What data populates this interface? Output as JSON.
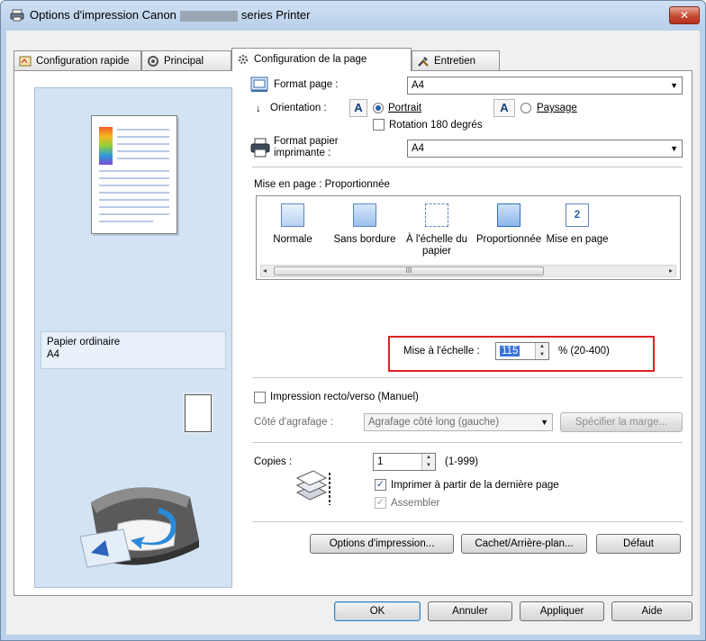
{
  "window": {
    "title_prefix": "Options d'impression Canon",
    "title_suffix": "series Printer",
    "close_label": "✕"
  },
  "tabs": [
    {
      "label": "Configuration rapide"
    },
    {
      "label": "Principal"
    },
    {
      "label": "Configuration de la page"
    },
    {
      "label": "Entretien"
    }
  ],
  "preview": {
    "media_type": "Papier ordinaire",
    "paper_size": "A4"
  },
  "page_setup": {
    "page_size_label": "Format page :",
    "page_size_value": "A4",
    "orientation_label": "Orientation :",
    "portrait_label": "Portrait",
    "landscape_label": "Paysage",
    "orientation_selected": "Portrait",
    "rotate_label": "Rotation 180 degrés",
    "rotate_checked": false,
    "printer_paper_label_1": "Format papier",
    "printer_paper_label_2": "imprimante :",
    "printer_paper_value": "A4",
    "icon_letter": "A"
  },
  "layout": {
    "label": "Mise en page : Proportionnée",
    "items": [
      {
        "label": "Normale"
      },
      {
        "label": "Sans bordure"
      },
      {
        "label": "À l'échelle du papier"
      },
      {
        "label": "Proportionnée"
      },
      {
        "label": "Mise en page"
      }
    ],
    "selected": "Proportionnée",
    "item5_badge": "2",
    "scroll_mark": "III"
  },
  "scaling": {
    "label": "Mise à l'échelle :",
    "value": "115",
    "range": "% (20-400)"
  },
  "duplex": {
    "label": "Impression recto/verso (Manuel)",
    "checked": false,
    "stapling_label": "Côté d'agrafage :",
    "stapling_value": "Agrafage côté long (gauche)",
    "margin_button": "Spécifier la marge..."
  },
  "copies": {
    "label": "Copies :",
    "value": "1",
    "range": "(1-999)",
    "reverse_label": "Imprimer à partir de la dernière page",
    "reverse_checked": true,
    "collate_label": "Assembler",
    "collate_checked": true
  },
  "bottom_buttons": {
    "print_options": "Options d'impression...",
    "stamp_background": "Cachet/Arrière-plan...",
    "defaults": "Défaut"
  },
  "dialog_buttons": {
    "ok": "OK",
    "cancel": "Annuler",
    "apply": "Appliquer",
    "help": "Aide"
  },
  "colors": {
    "accent": "#2a5fb0",
    "highlight_box": "#e02020",
    "title_bar": "#b9d1ea"
  }
}
